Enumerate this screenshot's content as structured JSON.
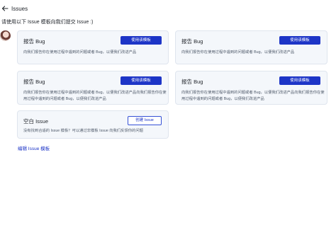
{
  "header": {
    "title": "Issues",
    "subtitle": "请使用以下 Issue 模板向我们提交 Issue :)"
  },
  "templates": [
    {
      "title": "报告 Bug",
      "button": "使用该模板",
      "desc_lines": [
        "向我们报告你在使用过程中遇到的问题或者 Bug，以便我们改进产品"
      ]
    },
    {
      "title": "报告 Bug",
      "button": "使用该模板",
      "desc_lines": [
        "向我们报告你在使用过程中遇到的问题或者 Bug，以便我们改进产品"
      ]
    },
    {
      "title": "报告 Bug",
      "button": "使用该模板",
      "desc_lines": [
        "向我们报告你在使用过程中遇到的问题或者 Bug，以便我们改进产品向我们报告你在使",
        "用过程中遇到的问题或者 Bug，以便我们改进产品"
      ]
    },
    {
      "title": "报告 Bug",
      "button": "使用该模板",
      "desc_lines": [
        "向我们报告你在使用过程中遇到的问题或者 Bug，以便我们改进产品向我们报告你在使",
        "用过程中遇到的问题或者 Bug，以便我们改进产品"
      ]
    }
  ],
  "blank_issue": {
    "title": "空白 Issue",
    "button": "创建 Issue",
    "desc": "没有找到合适的 Issue 模板？可以通过非模板 Issue 向我们反馈你的问题"
  },
  "edit_link": "编辑 Issue 模板",
  "colors": {
    "primary": "#1d35c7",
    "card_bg": "#f4f7fb",
    "card_border": "#dfe5ee"
  },
  "icons": {
    "back": "arrow-left-icon",
    "avatar": "user-avatar"
  }
}
